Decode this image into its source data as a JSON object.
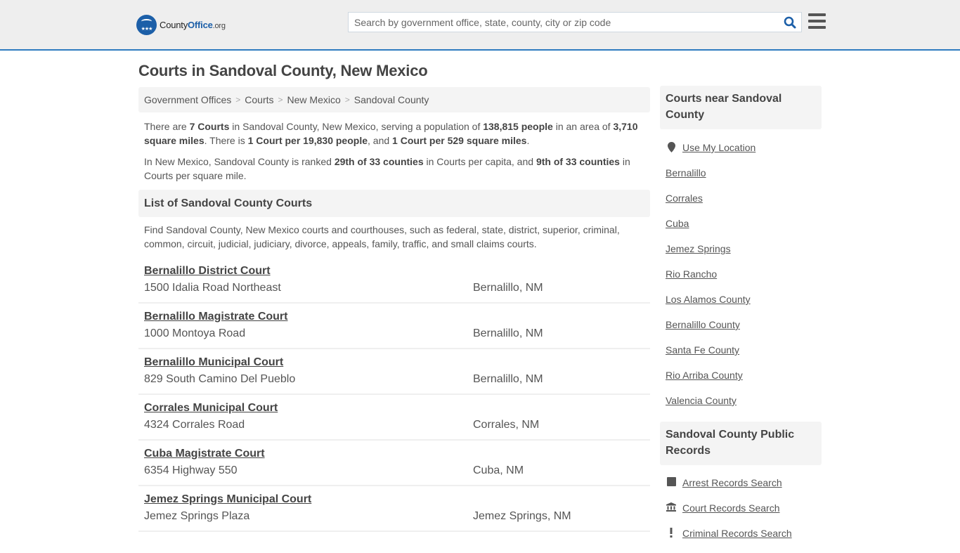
{
  "header": {
    "logo": {
      "brand_part1": "County",
      "brand_part2": "Office",
      "brand_suffix": ".org"
    },
    "search": {
      "placeholder": "Search by government office, state, county, city or zip code",
      "value": ""
    },
    "icons": {
      "search": "search-icon",
      "menu": "hamburger-menu-icon"
    },
    "accent_color": "#2f7bbf"
  },
  "page": {
    "title": "Courts in Sandoval County, New Mexico"
  },
  "breadcrumb": [
    {
      "label": "Government Offices"
    },
    {
      "label": "Courts"
    },
    {
      "label": "New Mexico"
    },
    {
      "label": "Sandoval County"
    }
  ],
  "intro": {
    "p1": {
      "t1": "There are ",
      "b1": "7 Courts",
      "t2": " in Sandoval County, New Mexico, serving a population of ",
      "b2": "138,815 people",
      "t3": " in an area of ",
      "b3": "3,710 square miles",
      "t4": ". There is ",
      "b4": "1 Court per 19,830 people",
      "t5": ", and ",
      "b5": "1 Court per 529 square miles",
      "t6": "."
    },
    "p2": {
      "t1": "In New Mexico, Sandoval County is ranked ",
      "b1": "29th of 33 counties",
      "t2": " in Courts per capita, and ",
      "b2": "9th of 33 counties",
      "t3": " in Courts per square mile."
    }
  },
  "list": {
    "heading": "List of Sandoval County Courts",
    "description": "Find Sandoval County, New Mexico courts and courthouses, such as federal, state, district, superior, criminal, common, circuit, judicial, judiciary, divorce, appeals, family, traffic, and small claims courts.",
    "courts": [
      {
        "name": "Bernalillo District Court",
        "address": "1500 Idalia Road Northeast",
        "city": "Bernalillo, NM"
      },
      {
        "name": "Bernalillo Magistrate Court",
        "address": "1000 Montoya Road",
        "city": "Bernalillo, NM"
      },
      {
        "name": "Bernalillo Municipal Court",
        "address": "829 South Camino Del Pueblo",
        "city": "Bernalillo, NM"
      },
      {
        "name": "Corrales Municipal Court",
        "address": "4324 Corrales Road",
        "city": "Corrales, NM"
      },
      {
        "name": "Cuba Magistrate Court",
        "address": "6354 Highway 550",
        "city": "Cuba, NM"
      },
      {
        "name": "Jemez Springs Municipal Court",
        "address": "Jemez Springs Plaza",
        "city": "Jemez Springs, NM"
      }
    ]
  },
  "sidebar": {
    "nearby": {
      "heading": "Courts near Sandoval County",
      "use_location": {
        "label": "Use My Location",
        "icon": "map-pin-icon"
      },
      "links": [
        "Bernalillo",
        "Corrales",
        "Cuba",
        "Jemez Springs",
        "Rio Rancho",
        "Los Alamos County",
        "Bernalillo County",
        "Santa Fe County",
        "Rio Arriba County",
        "Valencia County"
      ]
    },
    "records": {
      "heading": "Sandoval County Public Records",
      "links": [
        {
          "label": "Arrest Records Search",
          "icon": "square-icon"
        },
        {
          "label": "Court Records Search",
          "icon": "courthouse-icon"
        },
        {
          "label": "Criminal Records Search",
          "icon": "exclamation-icon"
        }
      ]
    }
  }
}
